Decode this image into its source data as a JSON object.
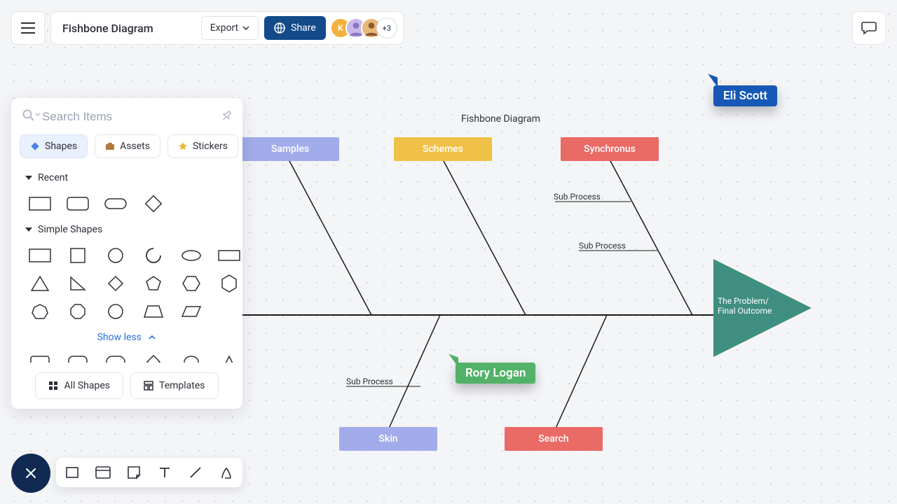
{
  "header": {
    "title": "Fishbone Diagram",
    "export_label": "Export",
    "share_label": "Share",
    "avatar_k": "K",
    "avatar_more": "+3"
  },
  "panel": {
    "search_placeholder": "Search Items",
    "tabs": {
      "shapes": "Shapes",
      "assets": "Assets",
      "stickers": "Stickers"
    },
    "sections": {
      "recent": "Recent",
      "simple": "Simple Shapes"
    },
    "show_less": "Show less",
    "all_shapes": "All Shapes",
    "templates": "Templates"
  },
  "diagram": {
    "title": "Fishbone Diagram",
    "top_boxes": {
      "samples": "Samples",
      "schemes": "Schemes",
      "synchronus": "Synchronus"
    },
    "bottom_boxes": {
      "skin": "Skin",
      "search": "Search"
    },
    "sub": {
      "sp1": "Sub Process",
      "sp2": "Sub Process",
      "sp3": "Sub Process"
    },
    "outcome_l1": "The Problem/",
    "outcome_l2": "Final Outcome"
  },
  "cursors": {
    "eli": "Eli Scott",
    "rory": "Rory Logan"
  }
}
